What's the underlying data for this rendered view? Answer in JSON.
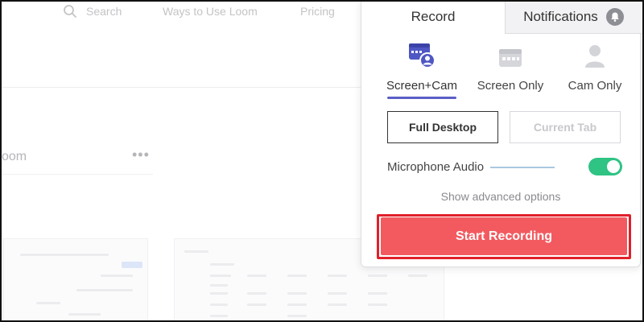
{
  "background": {
    "nav": {
      "search_label": "Search",
      "ways_label": "Ways to Use Loom",
      "pricing_label": "Pricing"
    },
    "title_fragment": "oom",
    "more_label": "•••"
  },
  "popup": {
    "tabs": [
      {
        "label": "Record"
      },
      {
        "label": "Notifications"
      }
    ],
    "modes": [
      {
        "label": "Screen+Cam",
        "icon": "screen-cam-icon",
        "selected": true
      },
      {
        "label": "Screen Only",
        "icon": "screen-icon",
        "selected": false
      },
      {
        "label": "Cam Only",
        "icon": "person-icon",
        "selected": false
      }
    ],
    "capture": {
      "full_desktop_label": "Full Desktop",
      "current_tab_label": "Current Tab"
    },
    "microphone": {
      "label": "Microphone Audio",
      "enabled": true
    },
    "advanced_label": "Show advanced options",
    "start_label": "Start Recording"
  },
  "colors": {
    "accent": "#5b5fc7",
    "start": "#f25a5f",
    "highlight": "#e0202a",
    "toggle_on": "#2fc384"
  }
}
